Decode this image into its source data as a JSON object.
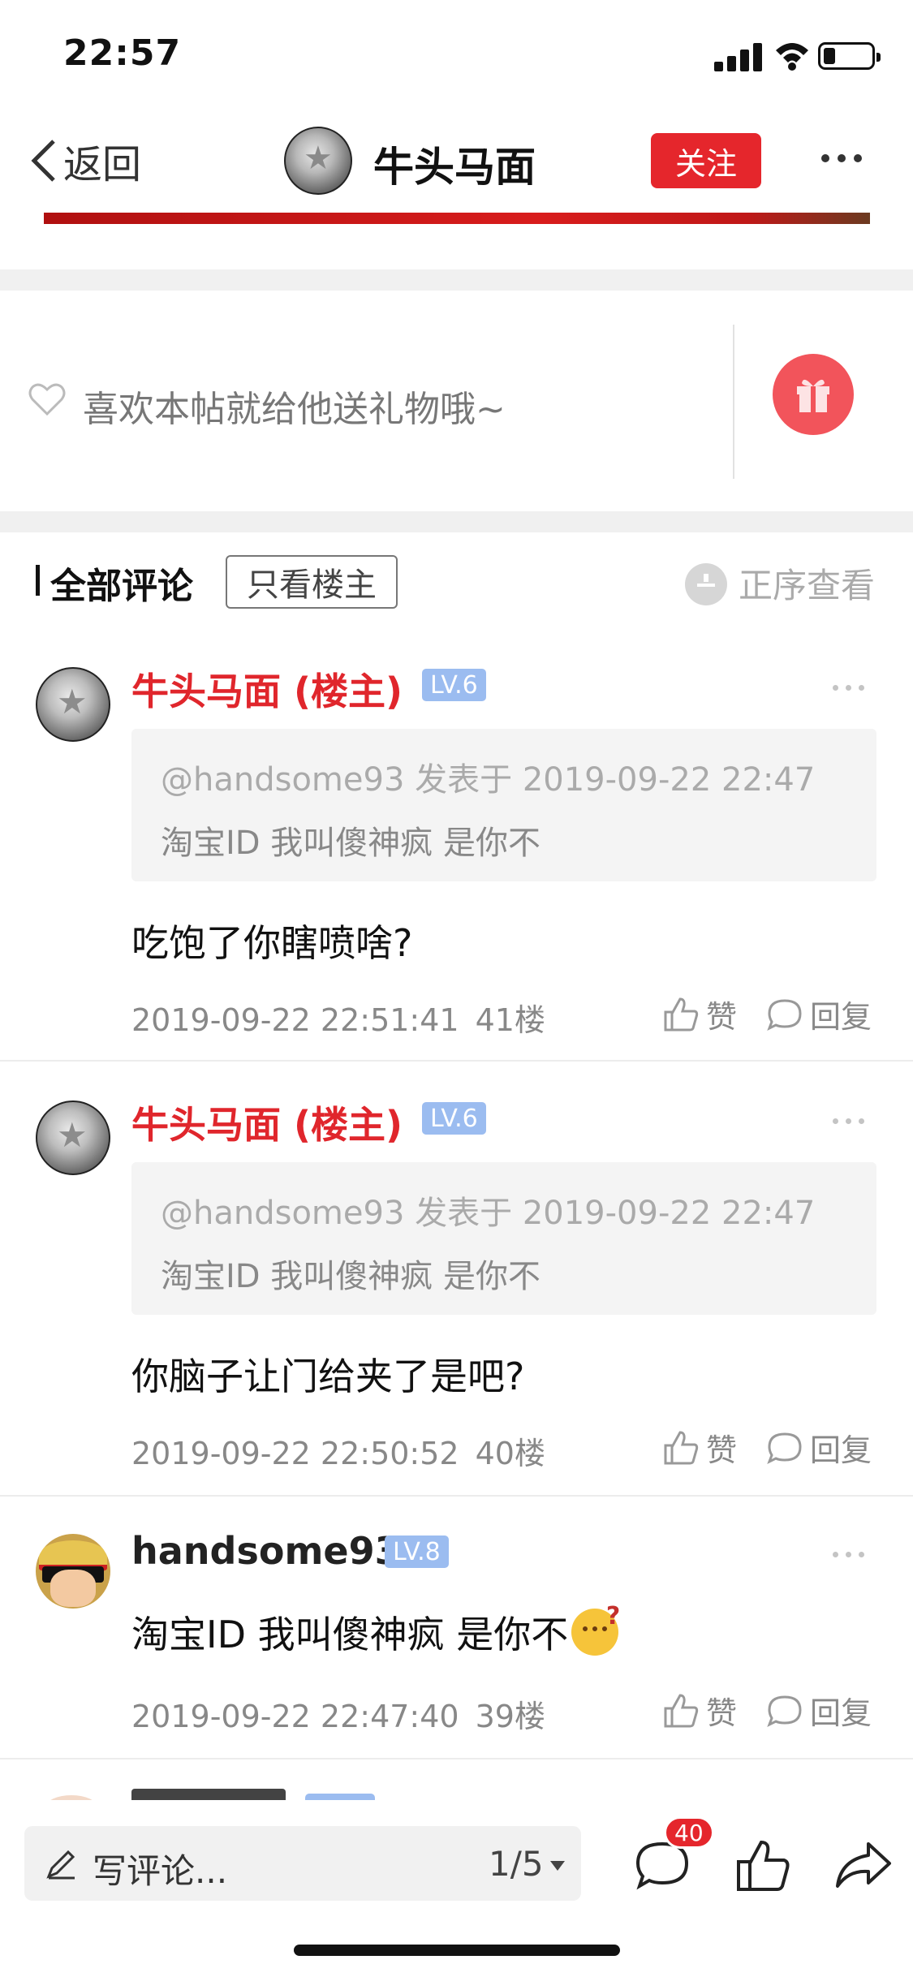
{
  "status_bar": {
    "time": "22:57"
  },
  "header": {
    "back_label": "返回",
    "title": "牛头马面",
    "follow_label": "关注"
  },
  "gift": {
    "prompt": "喜欢本帖就给他送礼物哦~"
  },
  "comments_section": {
    "title": "全部评论",
    "only_owner_label": "只看楼主",
    "sort_label": "正序查看"
  },
  "comments": [
    {
      "author": "牛头马面 (楼主)",
      "level": "LV.6",
      "quote_header": "@handsome93 发表于 2019-09-22 22:47",
      "quote_text": "淘宝ID 我叫傻神疯 是你不",
      "body": "吃饱了你瞎喷啥?",
      "time": "2019-09-22 22:51:41",
      "floor": "41楼",
      "like_label": "赞",
      "reply_label": "回复"
    },
    {
      "author": "牛头马面 (楼主)",
      "level": "LV.6",
      "quote_header": "@handsome93 发表于 2019-09-22 22:47",
      "quote_text": "淘宝ID 我叫傻神疯 是你不",
      "body": "你脑子让门给夹了是吧?",
      "time": "2019-09-22 22:50:52",
      "floor": "40楼",
      "like_label": "赞",
      "reply_label": "回复"
    },
    {
      "author": "handsome93",
      "level": "LV.8",
      "body": "淘宝ID 我叫傻神疯 是你不",
      "time": "2019-09-22 22:47:40",
      "floor": "39楼",
      "like_label": "赞",
      "reply_label": "回复"
    }
  ],
  "bottom_bar": {
    "input_placeholder": "写评论...",
    "page_indicator": "1/5",
    "comment_count_badge": "40"
  },
  "colors": {
    "accent_red": "#e5262c",
    "level_badge": "#9bbcf0",
    "gift_button": "#f2545b"
  }
}
